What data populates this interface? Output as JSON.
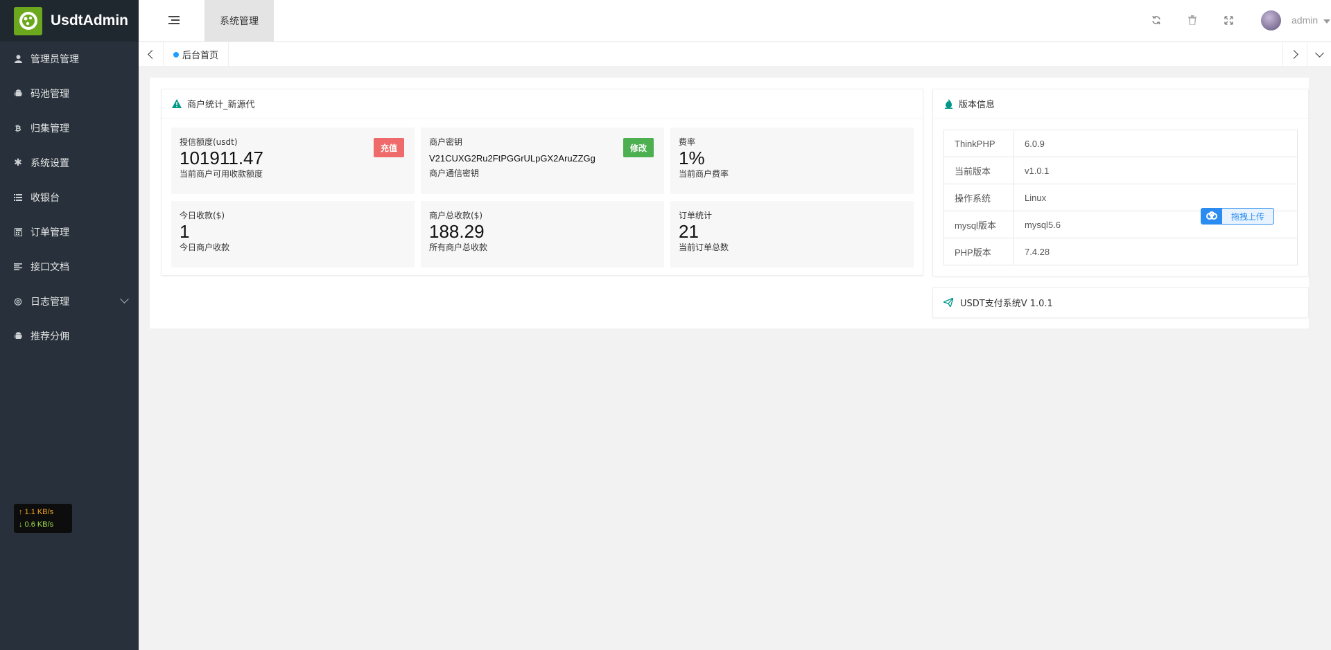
{
  "app": {
    "title": "UsdtAdmin"
  },
  "sidebar": {
    "items": [
      {
        "label": "管理员管理",
        "icon": "user-icon"
      },
      {
        "label": "码池管理",
        "icon": "android-icon"
      },
      {
        "label": "归集管理",
        "icon": "bitcoin-icon"
      },
      {
        "label": "系统设置",
        "icon": "asterisk-icon"
      },
      {
        "label": "收银台",
        "icon": "list-icon"
      },
      {
        "label": "订单管理",
        "icon": "calculator-icon"
      },
      {
        "label": "接口文档",
        "icon": "align-left-icon"
      },
      {
        "label": "日志管理",
        "icon": "cog-icon",
        "has_submenu": true
      },
      {
        "label": "推荐分佣",
        "icon": "android-icon"
      }
    ],
    "net_speed": {
      "up": "↑ 1.1 KB/s",
      "down": "↓ 0.6 KB/s"
    }
  },
  "header": {
    "active_tab": "系统管理",
    "user_name": "admin",
    "icons": [
      "refresh-icon",
      "trash-icon",
      "fullscreen-icon"
    ]
  },
  "tabs": {
    "home": "后台首页"
  },
  "merchant_panel": {
    "title": "商户统计_新源代",
    "cards": [
      {
        "label": "授信额度(usdt)",
        "value": "101911.47",
        "sub": "当前商户可用收款额度",
        "button": "充值"
      },
      {
        "label": "商户密钥",
        "value": "V21CUXG2Ru2FtPGGrULpGX2AruZZGg",
        "sub": "商户通信密钥",
        "button": "修改"
      },
      {
        "label": "费率",
        "value": "1%",
        "sub": "当前商户费率"
      },
      {
        "label": "今日收款($)",
        "value": "1",
        "sub": "今日商户收款"
      },
      {
        "label": "商户总收款($)",
        "value": "188.29",
        "sub": "所有商户总收款"
      },
      {
        "label": "订单统计",
        "value": "21",
        "sub": "当前订单总数"
      }
    ]
  },
  "version_panel": {
    "title": "版本信息",
    "rows": [
      {
        "key": "ThinkPHP",
        "value": "6.0.9"
      },
      {
        "key": "当前版本",
        "value": "v1.0.1"
      },
      {
        "key": "操作系统",
        "value": "Linux"
      },
      {
        "key": "mysql版本",
        "value": "mysql5.6"
      },
      {
        "key": "PHP版本",
        "value": "7.4.28"
      }
    ]
  },
  "system_panel": {
    "title": "USDT支付系统V 1.0.1"
  },
  "upload_widget": {
    "label": "拖拽上传"
  },
  "colors": {
    "sidebar_bg": "#28313b",
    "logo_bg": "#20282f",
    "accent_teal": "#009688",
    "btn_red": "#ef6b6b",
    "btn_green": "#4caf50",
    "tab_dot": "#1e9fff"
  }
}
